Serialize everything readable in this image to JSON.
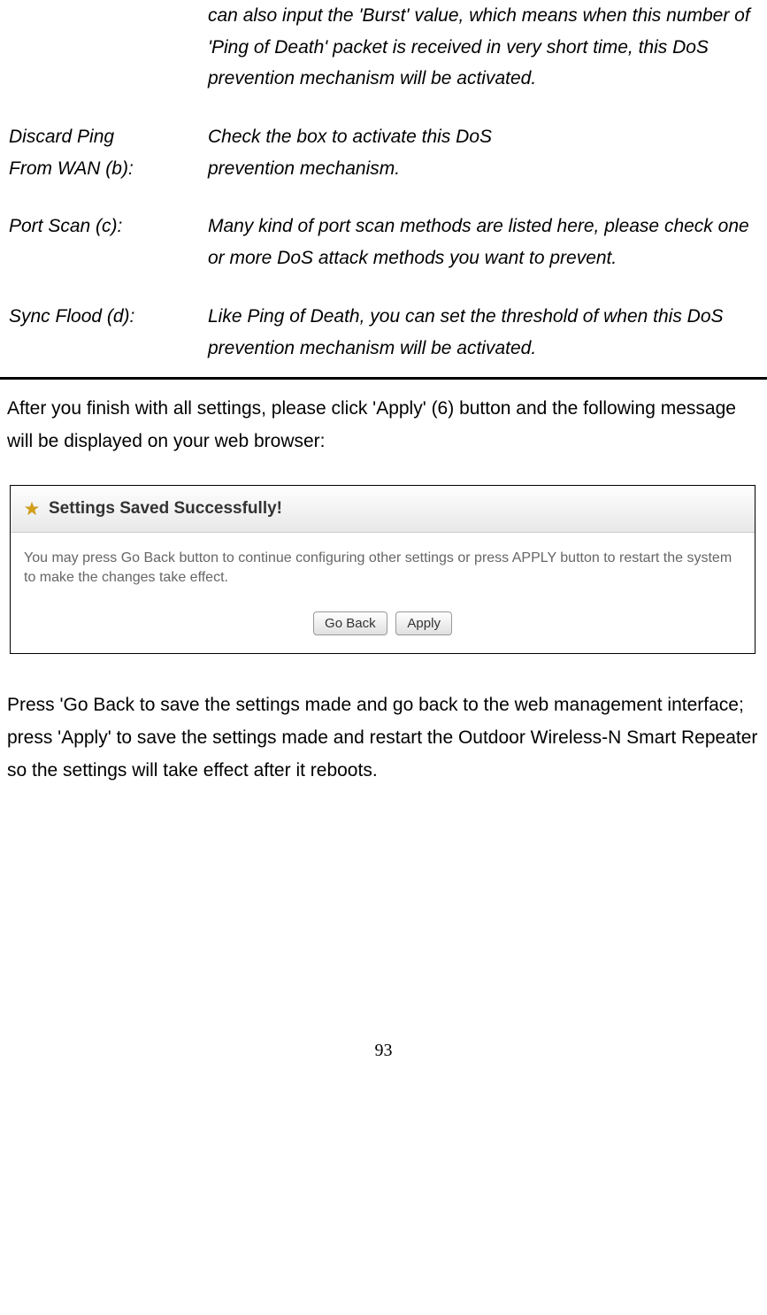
{
  "definitions": {
    "ping_of_death_fragment": "can also input the 'Burst' value, which means when this number of 'Ping of Death' packet is received in very short time, this DoS prevention mechanism will be activated.",
    "discard_ping": {
      "term_line1": "Discard Ping",
      "term_line2": "From WAN (b):",
      "desc_line1": "Check the box to activate this DoS",
      "desc_line2": "prevention mechanism."
    },
    "port_scan": {
      "term": "Port Scan (c):",
      "desc": "Many kind of port scan methods are listed here, please check one or more DoS attack methods you want to prevent."
    },
    "sync_flood": {
      "term": "Sync Flood (d):",
      "desc": "Like Ping of Death, you can set the threshold of when this DoS prevention mechanism will be activated."
    }
  },
  "para_after_table": "After you finish with all settings, please click 'Apply' (6) button and the following message will be displayed on your web browser:",
  "dialog": {
    "title": "Settings Saved Successfully!",
    "body": "You may press Go Back button to continue configuring other settings or press APPLY button to restart the system to make the changes take effect.",
    "go_back_label": "Go Back",
    "apply_label": "Apply"
  },
  "para_after_dialog": "Press 'Go Back to save the settings made and go back to the web management interface; press 'Apply' to save the settings made and restart the Outdoor Wireless-N Smart Repeater so the settings will take effect after it reboots.",
  "page_number": "93"
}
